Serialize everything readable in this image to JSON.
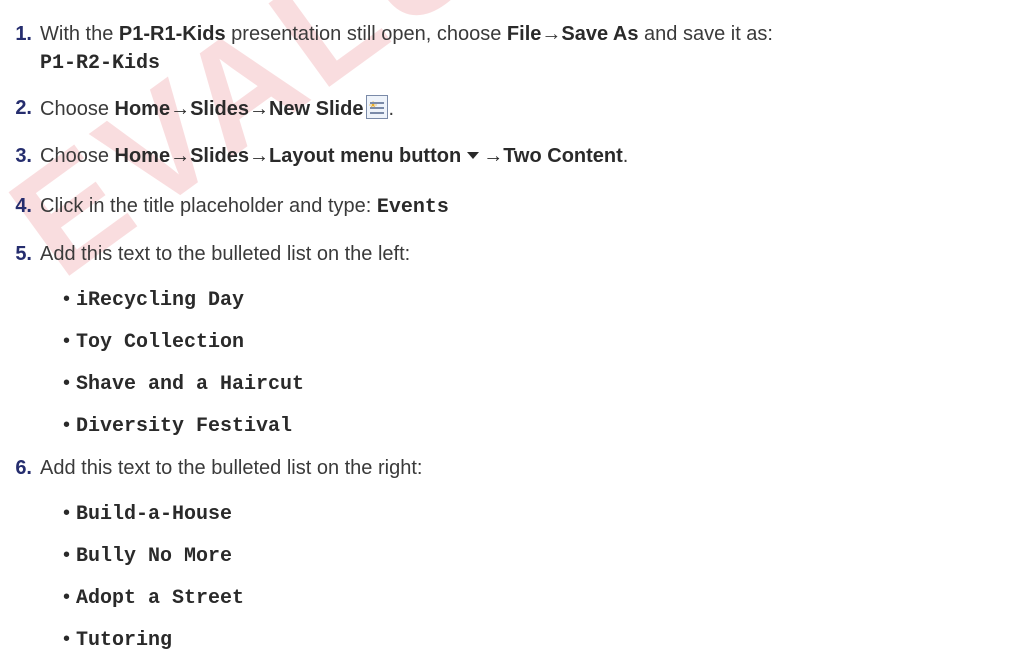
{
  "watermark": "EVALUATION",
  "steps": [
    {
      "num": "1.",
      "pre": "With the ",
      "b1": "P1-R1-Kids",
      "mid": " presentation still open, choose ",
      "b2": "File",
      "arrow": "→",
      "b3": "Save As",
      "post": " and save it as:",
      "code": "P1-R2-Kids"
    },
    {
      "num": "2.",
      "pre": "Choose ",
      "cmd": "Home→Slides→New Slide",
      "icon": "new-slide-icon",
      "post": "."
    },
    {
      "num": "3.",
      "pre": "Choose ",
      "cmd": "Home→Slides→Layout menu button",
      "cmd2": "→Two Content",
      "post": "."
    },
    {
      "num": "4.",
      "pre": "Click in the title placeholder and type: ",
      "code": "Events"
    },
    {
      "num": "5.",
      "pre": "Add this text to the bulleted list on the left:",
      "bullets": [
        "iRecycling Day",
        "Toy Collection",
        "Shave and a Haircut",
        "Diversity Festival"
      ]
    },
    {
      "num": "6.",
      "pre": "Add this text to the bulleted list on the right:",
      "bullets": [
        "Build-a-House",
        "Bully No More",
        "Adopt a Street",
        "Tutoring"
      ]
    }
  ],
  "bullet_char": "•"
}
